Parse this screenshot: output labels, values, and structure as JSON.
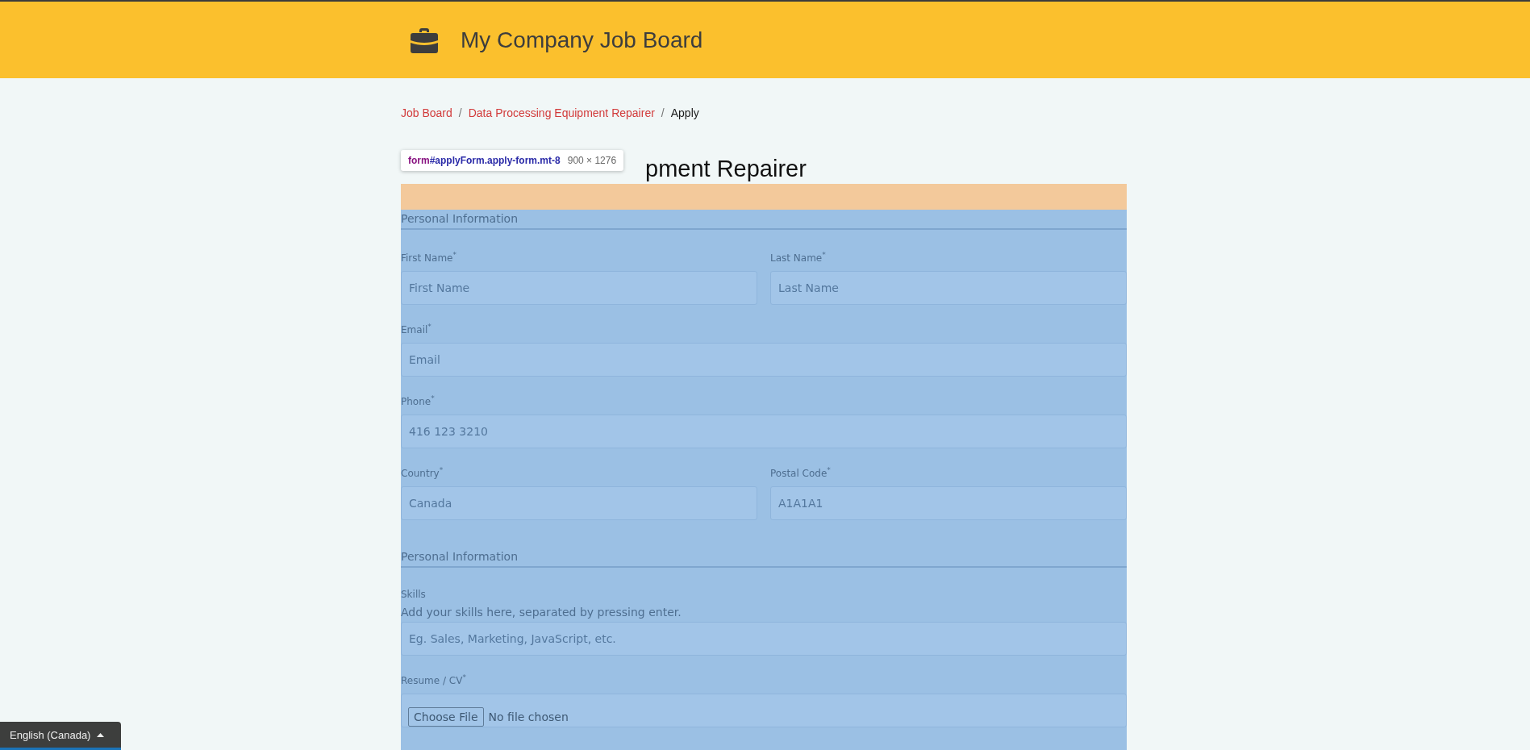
{
  "header": {
    "title": "My Company Job Board"
  },
  "breadcrumb_separator": "/",
  "breadcrumb": [
    {
      "label": "Job Board",
      "kind": "link"
    },
    {
      "label": "Data Processing Equipment Repairer",
      "kind": "link"
    },
    {
      "label": "Apply",
      "kind": "current"
    }
  ],
  "page_title": "pment Repairer",
  "inspector_tooltip": {
    "tag": "form",
    "selector": "#applyForm.apply-form.mt-8",
    "size": "900 × 1276"
  },
  "sections": [
    {
      "title": "Personal Information",
      "rows": [
        [
          {
            "kind": "text",
            "label": "First Name$^{*}$",
            "placeholder": "First Name"
          },
          {
            "kind": "text",
            "label": "Last Name$^{*}$",
            "placeholder": "Last Name"
          }
        ],
        [
          {
            "kind": "text",
            "label": "Email$^{*}$",
            "placeholder": "Email"
          }
        ],
        [
          {
            "kind": "text",
            "label": "Phone$^{*}$",
            "placeholder": "416 123 3210"
          }
        ],
        [
          {
            "kind": "text",
            "label": "Country$^{*}$",
            "placeholder": "Canada"
          },
          {
            "kind": "text",
            "label": "Postal Code$^{*}$",
            "placeholder": "A1A1A1"
          }
        ]
      ]
    },
    {
      "title": "Personal Information",
      "rows": [
        [
          {
            "kind": "text",
            "label": "Skills",
            "help": "Add your skills here, separated by pressing enter.",
            "placeholder": "Eg. Sales, Marketing, JavaScript, etc."
          }
        ],
        [
          {
            "kind": "file",
            "label": "Resume / CV$^{*}$",
            "button": "Choose File",
            "status": "No file chosen"
          }
        ]
      ]
    }
  ],
  "language_button": {
    "label": "English (Canada)"
  }
}
